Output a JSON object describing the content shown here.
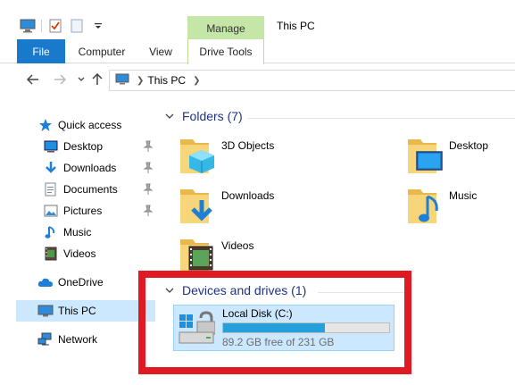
{
  "window": {
    "title": "This PC"
  },
  "ribbon": {
    "file_tab": "File",
    "tabs": [
      "Computer",
      "View"
    ],
    "context_group": "Manage",
    "context_tab": "Drive Tools"
  },
  "address": {
    "crumb": "This PC"
  },
  "sidebar": {
    "quick_access": "Quick access",
    "items": [
      {
        "label": "Desktop",
        "icon": "desktop-icon",
        "pinned": true
      },
      {
        "label": "Downloads",
        "icon": "downloads-icon",
        "pinned": true
      },
      {
        "label": "Documents",
        "icon": "documents-icon",
        "pinned": true
      },
      {
        "label": "Pictures",
        "icon": "pictures-icon",
        "pinned": true
      },
      {
        "label": "Music",
        "icon": "music-icon",
        "pinned": false
      },
      {
        "label": "Videos",
        "icon": "videos-icon",
        "pinned": false
      }
    ],
    "onedrive": "OneDrive",
    "this_pc": "This PC",
    "network": "Network"
  },
  "content": {
    "folders_header": "Folders (7)",
    "folders": [
      {
        "name": "3D Objects",
        "icon": "3d-objects-folder-icon"
      },
      {
        "name": "Desktop",
        "icon": "desktop-folder-icon"
      },
      {
        "name": "Downloads",
        "icon": "downloads-folder-icon"
      },
      {
        "name": "Music",
        "icon": "music-folder-icon"
      },
      {
        "name": "Videos",
        "icon": "videos-folder-icon"
      }
    ],
    "devices_header": "Devices and drives (1)",
    "drive": {
      "name": "Local Disk (C:)",
      "free_text": "89.2 GB free of 231 GB",
      "used_fraction": 0.614
    }
  },
  "colors": {
    "accent": "#1979ca",
    "context_tab": "#c4e6a6",
    "selection": "#cce8ff",
    "drive_fill": "#26a0da",
    "highlight": "#e01a22"
  }
}
